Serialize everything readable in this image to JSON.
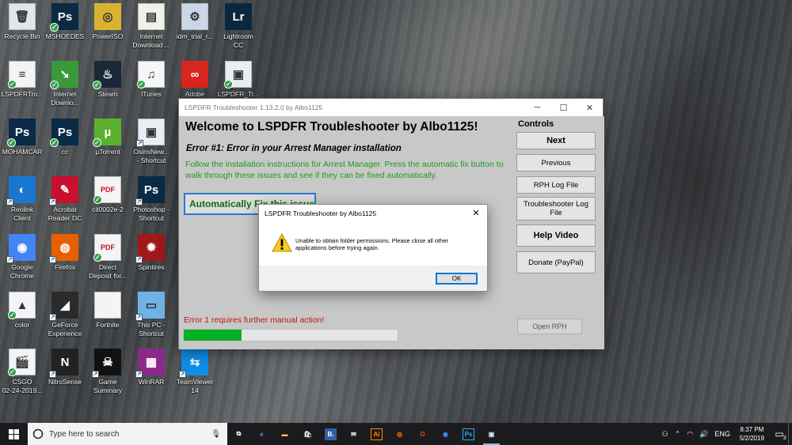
{
  "desktop": {
    "icons": [
      {
        "label": "Recycle Bin",
        "icon": "recycle-bin-icon",
        "color": "#dfe6ee",
        "glyph": "🗑",
        "badge": "none"
      },
      {
        "label": "MSHOEDES",
        "icon": "photoshop-file-icon",
        "color": "#0a2a45",
        "glyph": "Ps",
        "badge": "check"
      },
      {
        "label": "PowerISO",
        "icon": "poweriso-icon",
        "color": "#d9b330",
        "glyph": "◎",
        "badge": "none"
      },
      {
        "label": "Internet\nDownload ...",
        "icon": "internet-download-manager-icon",
        "color": "#f1f1ea",
        "glyph": "▤",
        "badge": "none"
      },
      {
        "label": "idm_trial_r...",
        "icon": "installer-icon",
        "color": "#c9d7e8",
        "glyph": "⚙",
        "badge": "none"
      },
      {
        "label": "Lightroom\nCC",
        "icon": "lightroom-icon",
        "color": "#0b2740",
        "glyph": "Lr",
        "badge": "none"
      },
      {
        "label": "LSPDFRTro...",
        "icon": "text-file-icon",
        "color": "#f4f4f4",
        "glyph": "≡",
        "badge": "check"
      },
      {
        "label": "Internet\nDownlo...",
        "icon": "idm-arrow-icon",
        "color": "#3a9a3a",
        "glyph": "➘",
        "badge": "check"
      },
      {
        "label": "Steam",
        "icon": "steam-icon",
        "color": "#1b2838",
        "glyph": "♨",
        "badge": "check"
      },
      {
        "label": "iTunes",
        "icon": "itunes-icon",
        "color": "#f6f6f6",
        "glyph": "♫",
        "badge": "check"
      },
      {
        "label": "Adobe\nCreati...",
        "icon": "creative-cloud-icon",
        "color": "#d9251d",
        "glyph": "∞",
        "badge": "none"
      },
      {
        "label": "LSPDFR_Tr...",
        "icon": "app-window-icon",
        "color": "#e7eef6",
        "glyph": "▣",
        "badge": "check"
      },
      {
        "label": "MOHAMCAR",
        "icon": "photoshop-file-icon",
        "color": "#0a2a45",
        "glyph": "Ps",
        "badge": "check"
      },
      {
        "label": "cc",
        "icon": "photoshop-file-icon",
        "color": "#0a2a45",
        "glyph": "Ps",
        "badge": "check"
      },
      {
        "label": "µTorrent",
        "icon": "utorrent-icon",
        "color": "#5cb030",
        "glyph": "µ",
        "badge": "check"
      },
      {
        "label": "OsirisNew...\n- Shortcut",
        "icon": "app-window-icon",
        "color": "#e7eef6",
        "glyph": "▣",
        "badge": "shortcut"
      },
      {
        "label": "Reolink\nClient",
        "icon": "reolink-icon",
        "color": "#1976d2",
        "glyph": "◐",
        "badge": "shortcut"
      },
      {
        "label": "Acrobat\nReader DC",
        "icon": "acrobat-icon",
        "color": "#c8102e",
        "glyph": "✎",
        "badge": "shortcut"
      },
      {
        "label": "cit0002e-2",
        "icon": "pdf-file-icon",
        "color": "#f4f4f4",
        "glyph": "PDF",
        "badge": "check"
      },
      {
        "label": "Photoshop -\nShortcut",
        "icon": "photoshop-icon",
        "color": "#0a2a45",
        "glyph": "Ps",
        "badge": "shortcut"
      },
      {
        "label": "Google\nChrome",
        "icon": "chrome-icon",
        "color": "#4285f4",
        "glyph": "◉",
        "badge": "shortcut"
      },
      {
        "label": "Firefox",
        "icon": "firefox-icon",
        "color": "#e66000",
        "glyph": "◍",
        "badge": "shortcut"
      },
      {
        "label": "Direct\nDeposit for...",
        "icon": "pdf-file-icon",
        "color": "#f4f4f4",
        "glyph": "PDF",
        "badge": "check"
      },
      {
        "label": "Spintires",
        "icon": "spintires-icon",
        "color": "#a01818",
        "glyph": "✹",
        "badge": "shortcut"
      },
      {
        "label": "color",
        "icon": "image-file-icon",
        "color": "#f2f4f7",
        "glyph": "▲",
        "badge": "check"
      },
      {
        "label": "GeForce\nExperience",
        "icon": "geforce-icon",
        "color": "#2b2b2b",
        "glyph": "◢",
        "badge": "shortcut"
      },
      {
        "label": "Fortnite",
        "icon": "blank-file-icon",
        "color": "#f4f4f4",
        "glyph": "",
        "badge": "none"
      },
      {
        "label": "This PC -\nShortcut",
        "icon": "this-pc-icon",
        "color": "#6fb3e6",
        "glyph": "▭",
        "badge": "shortcut"
      },
      {
        "label": "CSGO\n02-24-2019...",
        "icon": "video-file-icon",
        "color": "#f2f4f7",
        "glyph": "🎬",
        "badge": "check"
      },
      {
        "label": "NitroSense",
        "icon": "nitrosense-icon",
        "color": "#222222",
        "glyph": "N",
        "badge": "shortcut"
      },
      {
        "label": "Game\nSummary",
        "icon": "game-summary-icon",
        "color": "#111111",
        "glyph": "☠",
        "badge": "shortcut"
      },
      {
        "label": "WinRAR",
        "icon": "winrar-icon",
        "color": "#8c2a8c",
        "glyph": "▦",
        "badge": "shortcut"
      },
      {
        "label": "TeamViewer\n14",
        "icon": "teamviewer-icon",
        "color": "#0e8ee9",
        "glyph": "⇆",
        "badge": "shortcut"
      }
    ]
  },
  "app": {
    "title": "LSPDFR Troubleshooter 1.13.2.0 by Albo1125",
    "welcome": "Welcome to LSPDFR Troubleshooter by Albo1125!",
    "error_heading": "Error #1: Error in your Arrest Manager installation",
    "error_desc": "Follow the installation instructions for Arrest Manager. Press the automatic fix button to walk through these issues and see if they can be fixed automatically.",
    "auto_fix_label": "Automatically Fix this issue",
    "manual_action": "Error 1 requires further manual action!",
    "progress": 0.27,
    "progress_color": "#06b025",
    "controls": {
      "heading": "Controls",
      "next": "Next",
      "previous": "Previous",
      "rph_log": "RPH Log File",
      "troubleshooter_log": "Troubleshooter Log File",
      "help_video": "Help Video",
      "donate": "Donate (PayPal)",
      "open_rph": "Open RPH"
    }
  },
  "dialog": {
    "title": "LSPDFR Troubleshooter by Albo1125",
    "message": "Unable to obtain folder permissions. Please close all other applications before trying again.",
    "ok": "OK"
  },
  "taskbar": {
    "search_placeholder": "Type here to search",
    "apps": [
      {
        "name": "task-view",
        "color": "#ffffff",
        "glyph": "⧉"
      },
      {
        "name": "edge",
        "color": "#3a8ee6",
        "glyph": "e"
      },
      {
        "name": "file-explorer",
        "color": "#f2c14e",
        "glyph": "▬"
      },
      {
        "name": "store",
        "color": "#ffffff",
        "glyph": "🛍"
      },
      {
        "name": "b-app",
        "color": "#2f5fa8",
        "glyph": "B."
      },
      {
        "name": "mail",
        "color": "#ffffff",
        "glyph": "✉"
      },
      {
        "name": "illustrator",
        "color": "#ff8a00",
        "glyph": "Ai"
      },
      {
        "name": "firefox",
        "color": "#e66000",
        "glyph": "◍"
      },
      {
        "name": "office",
        "color": "#e2471e",
        "glyph": "O"
      },
      {
        "name": "chrome",
        "color": "#4285f4",
        "glyph": "◉"
      },
      {
        "name": "photoshop",
        "color": "#31a8ff",
        "glyph": "Ps"
      },
      {
        "name": "lspdfr-troubleshooter",
        "color": "#d8e4f0",
        "glyph": "▣"
      }
    ],
    "language": "ENG",
    "time": "8:37 PM",
    "date": "5/2/2019",
    "notification_count": "3"
  }
}
